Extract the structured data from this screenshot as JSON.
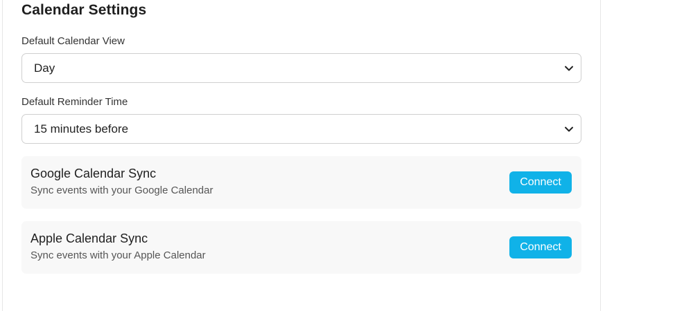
{
  "section_title": "Calendar Settings",
  "default_view": {
    "label": "Default Calendar View",
    "selected": "Day",
    "icon": "chevron-down-icon"
  },
  "default_reminder": {
    "label": "Default Reminder Time",
    "selected": "15 minutes before",
    "icon": "chevron-down-icon"
  },
  "integrations": [
    {
      "title": "Google Calendar Sync",
      "description": "Sync events with your Google Calendar",
      "button_label": "Connect"
    },
    {
      "title": "Apple Calendar Sync",
      "description": "Sync events with your Apple Calendar",
      "button_label": "Connect"
    }
  ],
  "colors": {
    "accent": "#10b2e8",
    "card_background": "#f8f8f8",
    "border": "#cfcfcf"
  }
}
